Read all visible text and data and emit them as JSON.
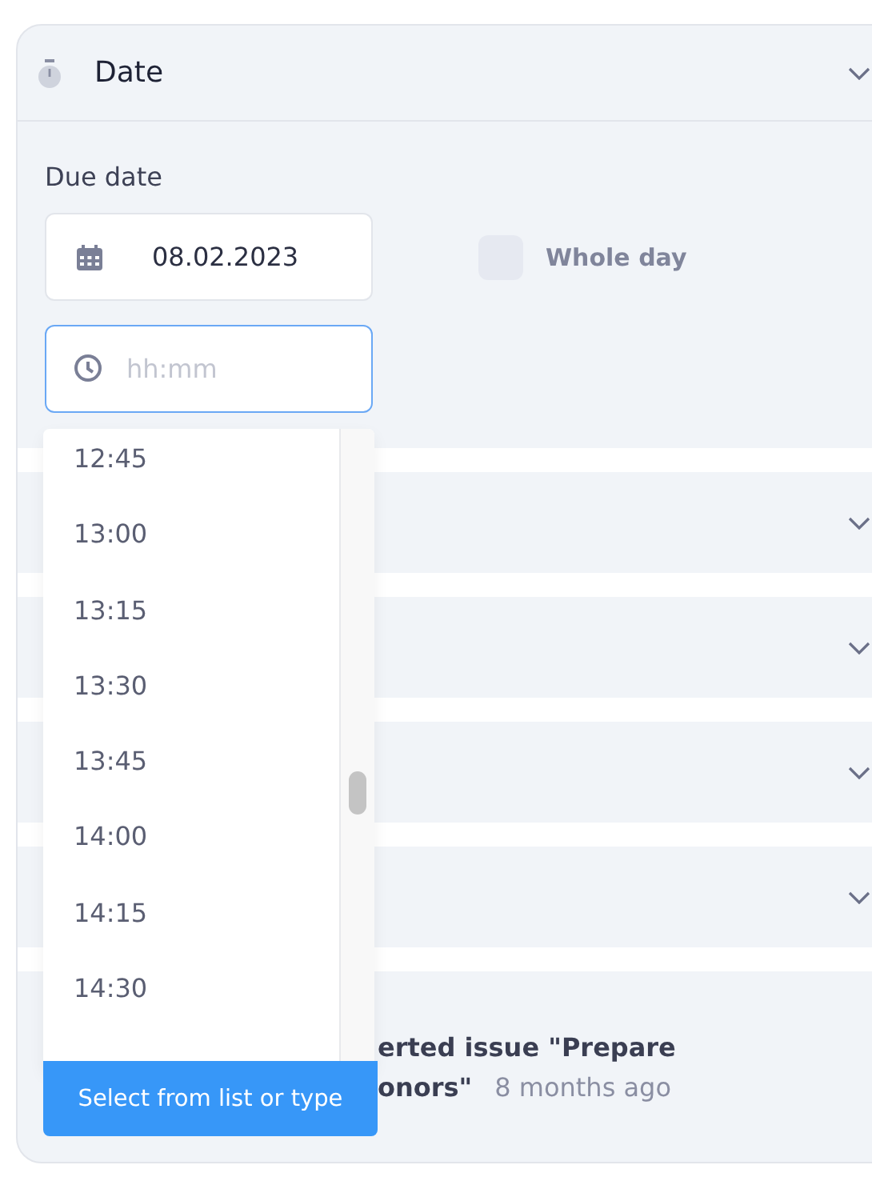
{
  "date_section": {
    "title": "Date",
    "expanded": true,
    "due_date_label": "Due date",
    "date_value": "08.02.2023",
    "whole_day": {
      "label": "Whole day",
      "checked": false
    },
    "time_placeholder": "hh:mm"
  },
  "collapsed_sections": [
    {
      "expanded": false
    },
    {
      "expanded": false
    },
    {
      "expanded": false
    },
    {
      "expanded": false
    }
  ],
  "time_dropdown": {
    "options": [
      "12:45",
      "13:00",
      "13:15",
      "13:30",
      "13:45",
      "14:00",
      "14:15",
      "14:30"
    ],
    "tooltip": "Select from list or type"
  },
  "activity": {
    "line_1": "erted issue \"Prepare",
    "line_2": "onors\"",
    "time": "8 months ago"
  }
}
